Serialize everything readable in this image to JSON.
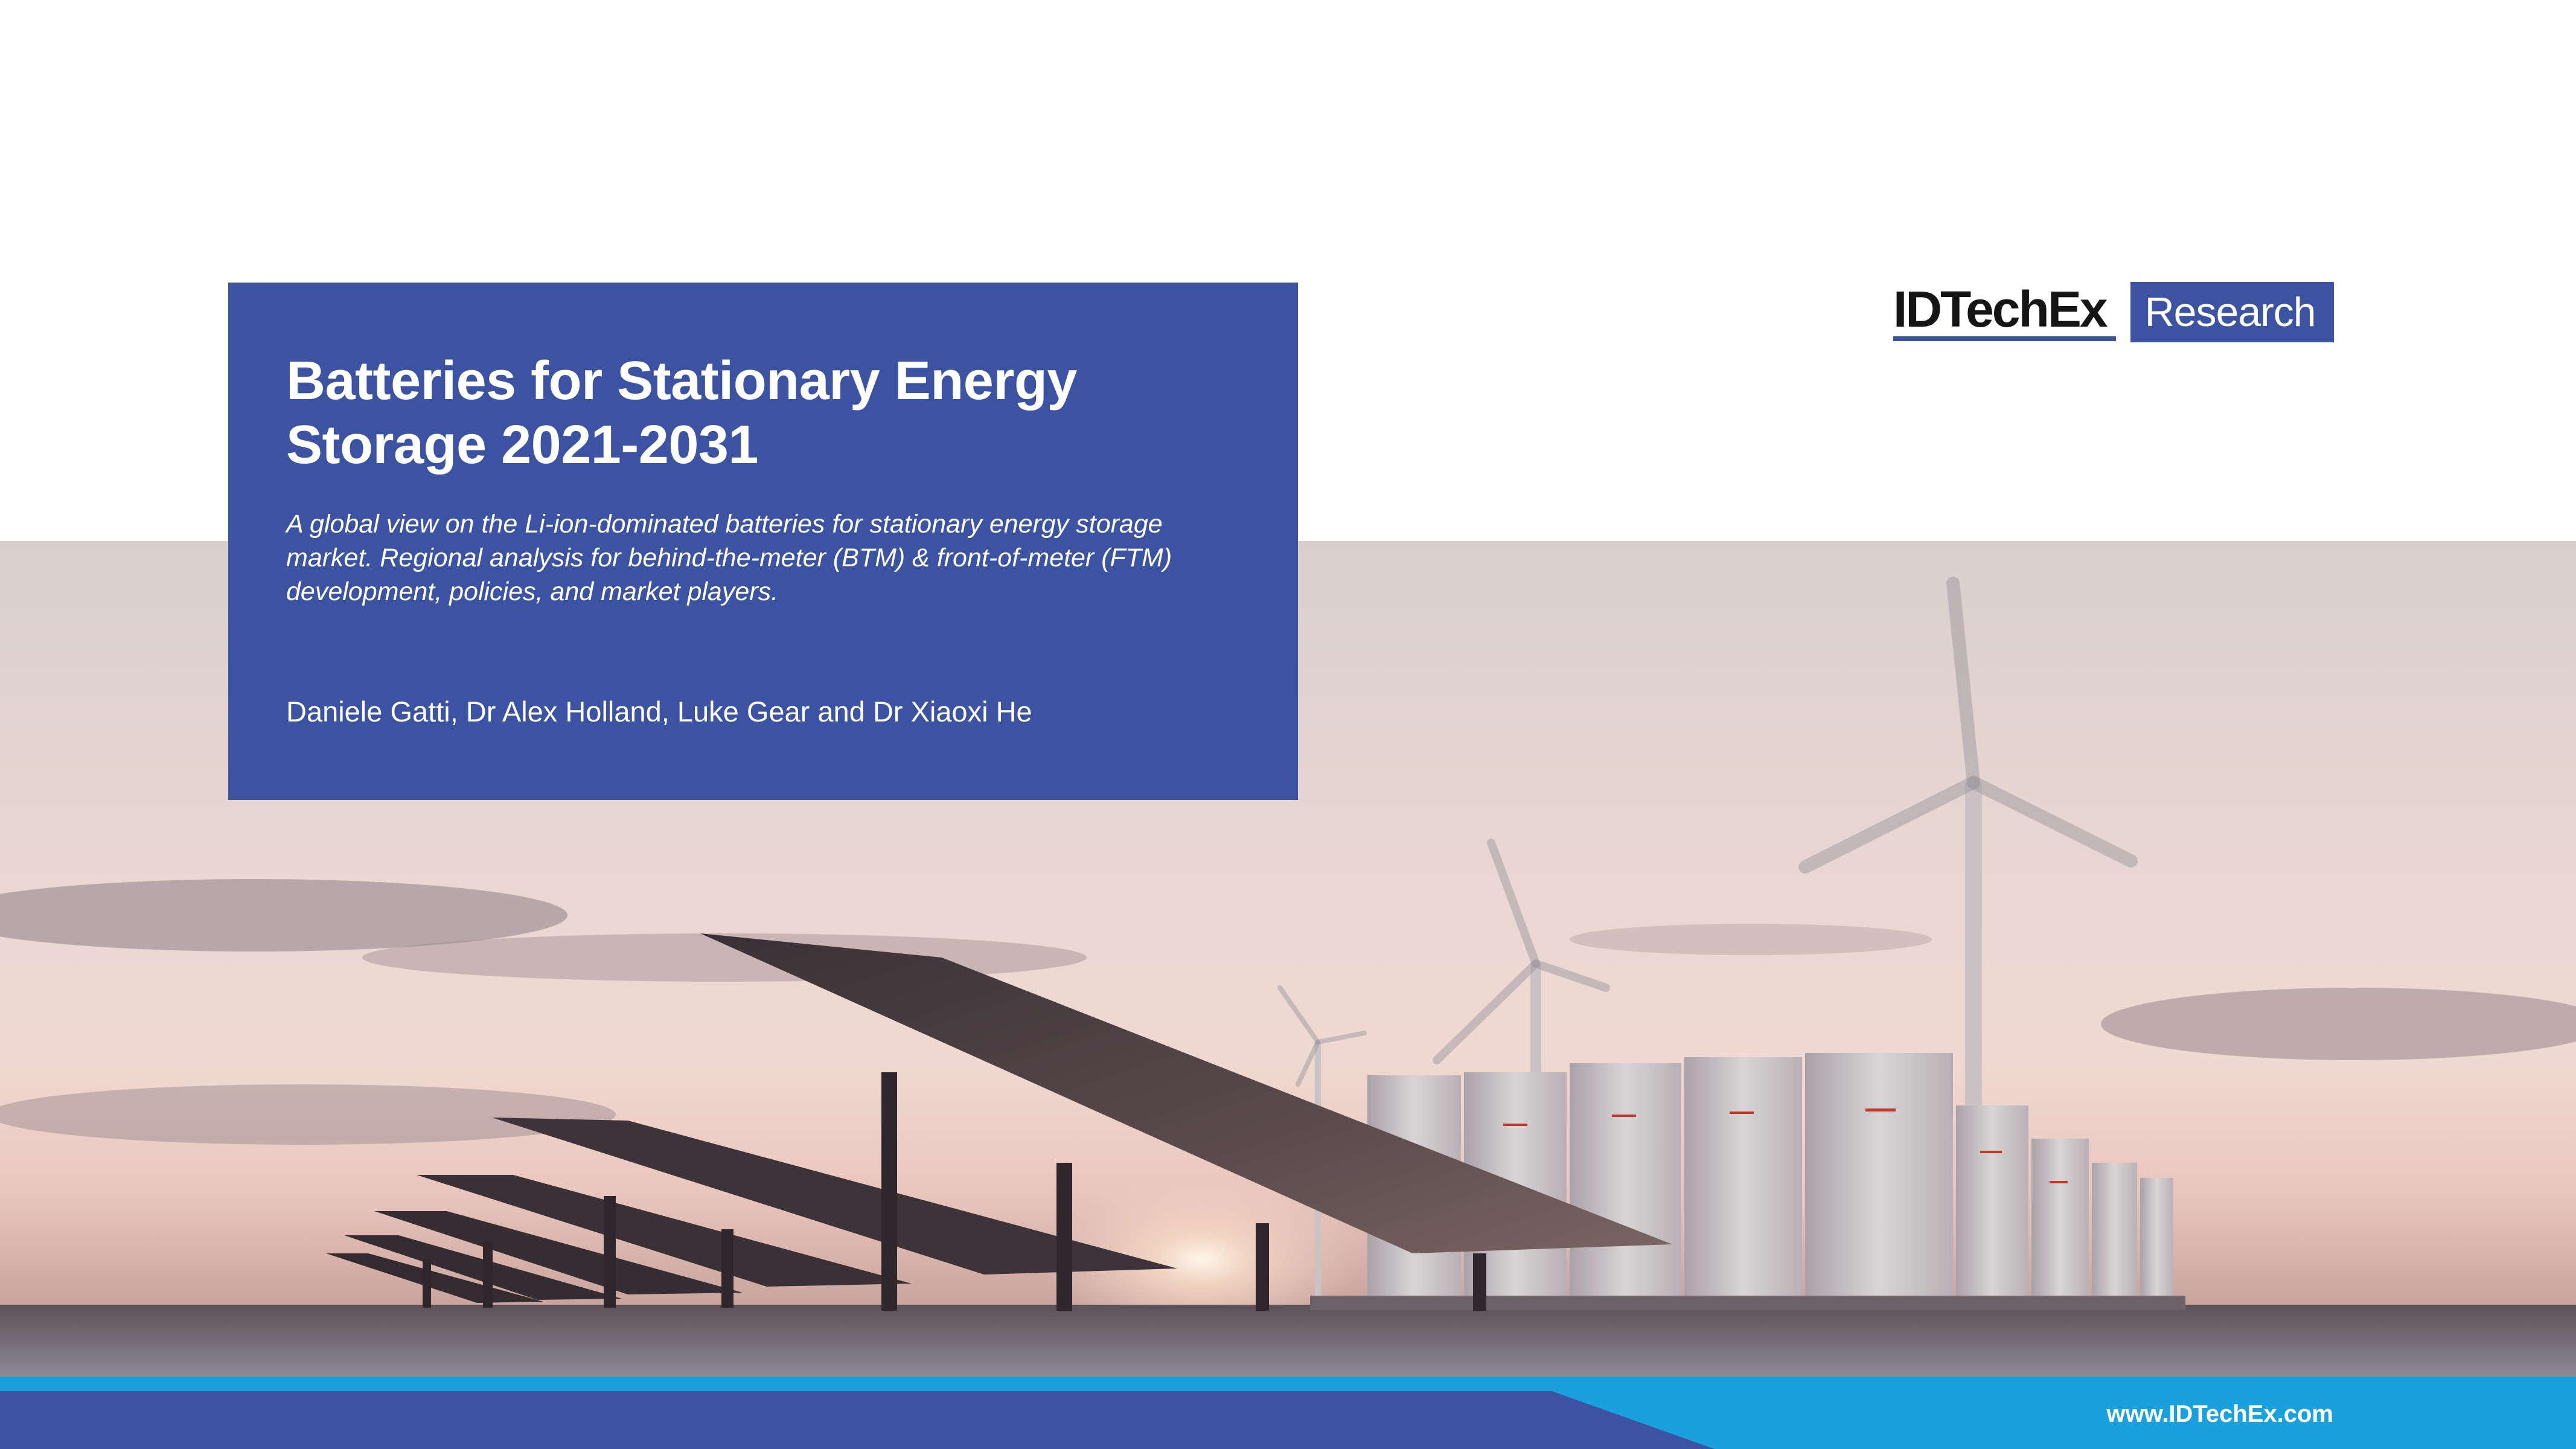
{
  "report": {
    "title": "Batteries for Stationary Energy Storage 2021-2031",
    "subtitle": "A global view on the Li-ion-dominated batteries for stationary energy storage market. Regional analysis for behind-the-meter (BTM) & front-of-meter (FTM) development, policies, and market players.",
    "authors": "Daniele Gatti, Dr Alex Holland, Luke Gear and Dr Xiaoxi He"
  },
  "brand": {
    "name": "IDTechEx",
    "tag": "Research",
    "url": "www.IDTechEx.com"
  },
  "colors": {
    "brand_blue": "#3c53a2",
    "footer_light_blue": "#1aa0dc",
    "footer_dark_blue": "#3c53a2"
  },
  "hero_image": {
    "description_icon": "solar-wind-battery-landscape-photo"
  }
}
